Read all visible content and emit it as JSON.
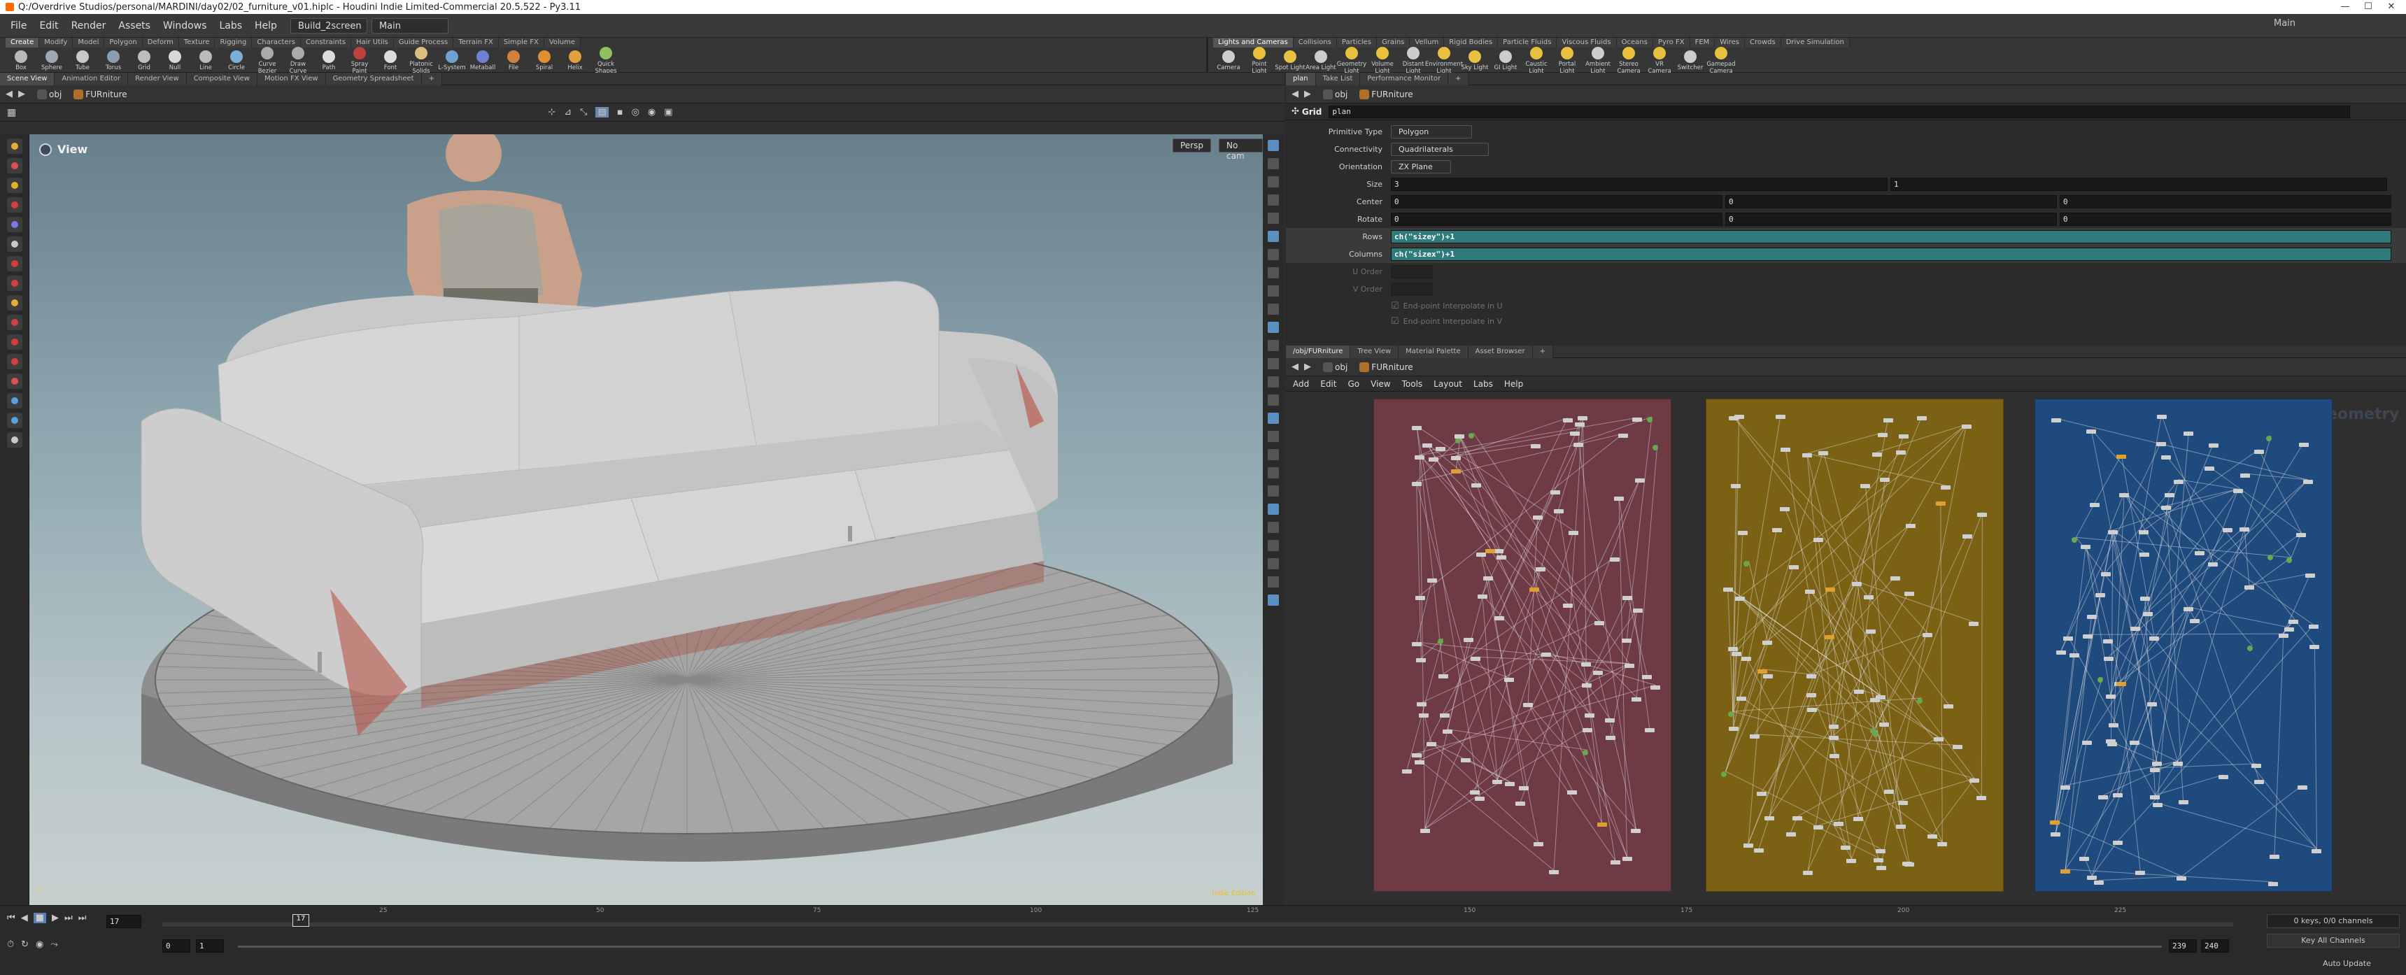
{
  "window": {
    "title": "Q:/Overdrive Studios/personal/MARDINI/day02/02_furniture_v01.hiplc - Houdini Indie Limited-Commercial 20.5.522 - Py3.11",
    "right_label": "Main"
  },
  "menubar": {
    "items": [
      "File",
      "Edit",
      "Render",
      "Assets",
      "Windows",
      "Labs",
      "Help"
    ],
    "desktop": "Build_2screen",
    "desk2": "Main"
  },
  "shelf_left": {
    "tabs": [
      "Create",
      "Modify",
      "Model",
      "Polygon",
      "Deform",
      "Texture",
      "Rigging",
      "Characters",
      "Constraints",
      "Hair Utils",
      "Guide Process",
      "Terrain FX",
      "Simple FX",
      "Volume"
    ],
    "tools": [
      "Box",
      "Sphere",
      "Tube",
      "Torus",
      "Grid",
      "Null",
      "Line",
      "Circle",
      "Curve Bezier",
      "Draw Curve",
      "Path",
      "Spray Paint",
      "Font",
      "Platonic Solids",
      "L-System",
      "Metaball",
      "File",
      "Spiral",
      "Helix",
      "Quick Shapes"
    ]
  },
  "shelf_right": {
    "tabs": [
      "Lights and Cameras",
      "Collisions",
      "Particles",
      "Grains",
      "Vellum",
      "Rigid Bodies",
      "Particle Fluids",
      "Viscous Fluids",
      "Oceans",
      "Pyro FX",
      "FEM",
      "Wires",
      "Crowds",
      "Drive Simulation"
    ],
    "tools": [
      "Camera",
      "Point Light",
      "Spot Light",
      "Area Light",
      "Geometry Light",
      "Volume Light",
      "Distant Light",
      "Environment Light",
      "Sky Light",
      "GI Light",
      "Caustic Light",
      "Portal Light",
      "Ambient Light",
      "Stereo Camera",
      "VR Camera",
      "Switcher",
      "Gamepad Camera"
    ]
  },
  "left_panel": {
    "tabs": [
      "Scene View",
      "Animation Editor",
      "Render View",
      "Composite View",
      "Motion FX View",
      "Geometry Spreadsheet"
    ],
    "path": [
      "obj",
      "FURniture"
    ],
    "viewport_label": "View",
    "persp": "Persp",
    "cam": "No cam",
    "status_text": "Indie Edition"
  },
  "parm_panel": {
    "tabs": [
      "plan",
      "Take List",
      "Performance Monitor"
    ],
    "path": [
      "obj",
      "FURniture"
    ],
    "node_type": "Grid",
    "node_name": "plan",
    "params": [
      {
        "label": "Primitive Type",
        "value": "Polygon",
        "kind": "menu"
      },
      {
        "label": "Connectivity",
        "value": "Quadrilaterals",
        "kind": "menu"
      },
      {
        "label": "Orientation",
        "value": "ZX Plane",
        "kind": "menu"
      }
    ],
    "size": [
      "3",
      "1"
    ],
    "center": [
      "0",
      "0",
      "0"
    ],
    "rotate": [
      "0",
      "0",
      "0"
    ],
    "rows": "ch(\"sizey\")+1",
    "columns": "ch(\"sizex\")+1",
    "labels": {
      "size": "Size",
      "center": "Center",
      "rotate": "Rotate",
      "rows": "Rows",
      "columns": "Columns",
      "uorder": "U Order",
      "vorder": "V Order"
    },
    "checks": [
      "End-point Interpolate in U",
      "End-point Interpolate in V"
    ]
  },
  "network_panel": {
    "tabs": [
      "/obj/FURniture",
      "Tree View",
      "Material Palette",
      "Asset Browser"
    ],
    "path": [
      "obj",
      "FURniture"
    ],
    "menu": [
      "Add",
      "Edit",
      "Go",
      "View",
      "Tools",
      "Layout",
      "Labs",
      "Help"
    ],
    "context_label": "Geometry",
    "box_colors": [
      "#6e3a44",
      "#7a6114",
      "#1f4a7d"
    ]
  },
  "timeline": {
    "frame": "17",
    "start": "0",
    "start2": "1",
    "end": "239",
    "end2": "240",
    "ticks": [
      "25",
      "50",
      "75",
      "100",
      "125",
      "150",
      "175",
      "200",
      "225"
    ],
    "keys": "0 keys, 0/0 channels",
    "key_all": "Key All Channels",
    "auto_update": "Auto Update"
  }
}
